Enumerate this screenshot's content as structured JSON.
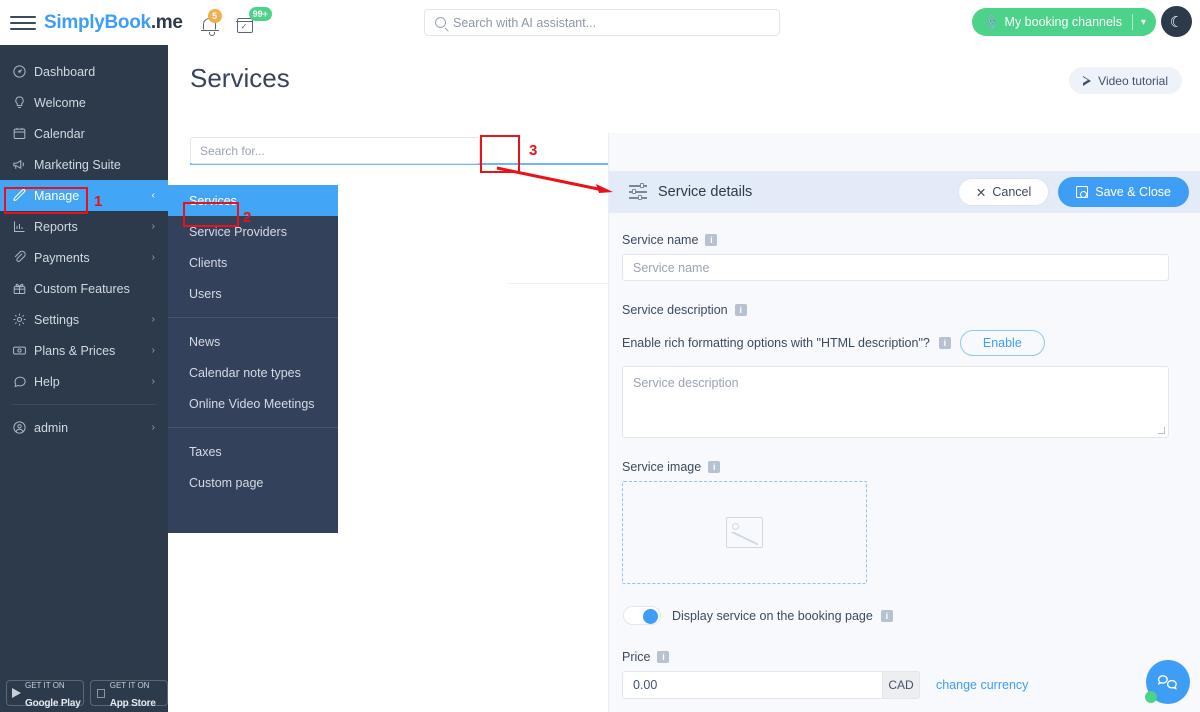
{
  "topbar": {
    "menu_icon": "hamburger-icon",
    "brand_s": "S",
    "brand_main": "implyBook",
    "brand_suffix": ".me",
    "bell_badge": "5",
    "calendar_badge": "99+",
    "search_placeholder": "Search with AI assistant...",
    "booking_button": "My booking channels",
    "theme_toggle_icon": "moon-icon"
  },
  "sidebar": {
    "items": [
      {
        "label": "Dashboard",
        "icon": "gauge-icon",
        "chevron": "",
        "active": false
      },
      {
        "label": "Welcome",
        "icon": "bulb-icon",
        "chevron": "",
        "active": false
      },
      {
        "label": "Calendar",
        "icon": "calendar-icon",
        "chevron": "",
        "active": false
      },
      {
        "label": "Marketing Suite",
        "icon": "megaphone-icon",
        "chevron": "",
        "active": false
      },
      {
        "label": "Manage",
        "icon": "pencil-icon",
        "chevron": "‹",
        "active": true
      },
      {
        "label": "Reports",
        "icon": "bar-chart-icon",
        "chevron": "›",
        "active": false
      },
      {
        "label": "Payments",
        "icon": "paperclip-icon",
        "chevron": "›",
        "active": false
      },
      {
        "label": "Custom Features",
        "icon": "gift-icon",
        "chevron": "",
        "active": false
      },
      {
        "label": "Settings",
        "icon": "gear-icon",
        "chevron": "›",
        "active": false
      },
      {
        "label": "Plans & Prices",
        "icon": "banknote-icon",
        "chevron": "›",
        "active": false
      },
      {
        "label": "Help",
        "icon": "chat-icon",
        "chevron": "›",
        "active": false
      }
    ],
    "account": {
      "label": "admin",
      "icon": "user-circle-icon",
      "chevron": "›"
    },
    "store_badges": [
      {
        "small": "GET IT ON",
        "big": "Google Play",
        "icon": "google-play-icon"
      },
      {
        "small": "GET IT ON",
        "big": "App Store",
        "icon": "apple-icon"
      }
    ]
  },
  "submenu": {
    "group1": [
      {
        "label": "Services",
        "active": true
      },
      {
        "label": "Service Providers",
        "active": false
      },
      {
        "label": "Clients",
        "active": false
      },
      {
        "label": "Users",
        "active": false
      }
    ],
    "group2": [
      {
        "label": "News",
        "active": false
      },
      {
        "label": "Calendar note types",
        "active": false
      },
      {
        "label": "Online Video Meetings",
        "active": false
      }
    ],
    "group3": [
      {
        "label": "Taxes",
        "active": false
      },
      {
        "label": "Custom page",
        "active": false
      }
    ]
  },
  "main": {
    "page_title": "Services",
    "video_tutorial": "Video tutorial",
    "search_placeholder": "Search for...",
    "add_button": "+",
    "eye_icon": "eye-icon"
  },
  "details": {
    "header_title": "Service details",
    "cancel": "Cancel",
    "save": "Save & Close",
    "service_name_label": "Service name",
    "service_name_placeholder": "Service name",
    "service_description_label": "Service description",
    "html_question": "Enable rich formatting options with \"HTML description\"?",
    "enable_button": "Enable",
    "service_description_placeholder": "Service description",
    "service_image_label": "Service image",
    "display_toggle_label": "Display service on the booking page",
    "price_label": "Price",
    "price_value": "0.00",
    "currency": "CAD",
    "change_currency": "change currency",
    "info_glyph": "i"
  },
  "annotations": [
    {
      "num": "1",
      "target": "sidebar-item-manage"
    },
    {
      "num": "2",
      "target": "submenu-item-services"
    },
    {
      "num": "3",
      "target": "add-service-button"
    }
  ],
  "colors": {
    "sidebar_bg": "#2c3a4b",
    "submenu_bg": "#33415a",
    "accent_blue": "#3e9ef5",
    "active_blue": "#42a5f5",
    "green": "#4cd38a",
    "annotation_red": "#e8131a",
    "panel_bg": "#f7f9fd",
    "panel_head_bg": "#e3ebf8"
  }
}
